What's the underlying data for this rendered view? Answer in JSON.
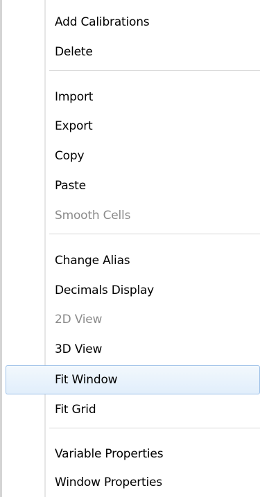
{
  "menu": {
    "items": [
      {
        "label": "Add Calibrations",
        "disabled": false
      },
      {
        "label": "Delete",
        "disabled": false
      },
      {
        "label": "Import",
        "disabled": false
      },
      {
        "label": "Export",
        "disabled": false
      },
      {
        "label": "Copy",
        "disabled": false
      },
      {
        "label": "Paste",
        "disabled": false
      },
      {
        "label": "Smooth Cells",
        "disabled": true
      },
      {
        "label": "Change Alias",
        "disabled": false
      },
      {
        "label": "Decimals Display",
        "disabled": false
      },
      {
        "label": "2D View",
        "disabled": true
      },
      {
        "label": "3D View",
        "disabled": false
      },
      {
        "label": "Fit Window",
        "disabled": false,
        "highlighted": true
      },
      {
        "label": "Fit Grid",
        "disabled": false
      },
      {
        "label": "Variable Properties",
        "disabled": false
      },
      {
        "label": "Window Properties",
        "disabled": false
      }
    ]
  }
}
